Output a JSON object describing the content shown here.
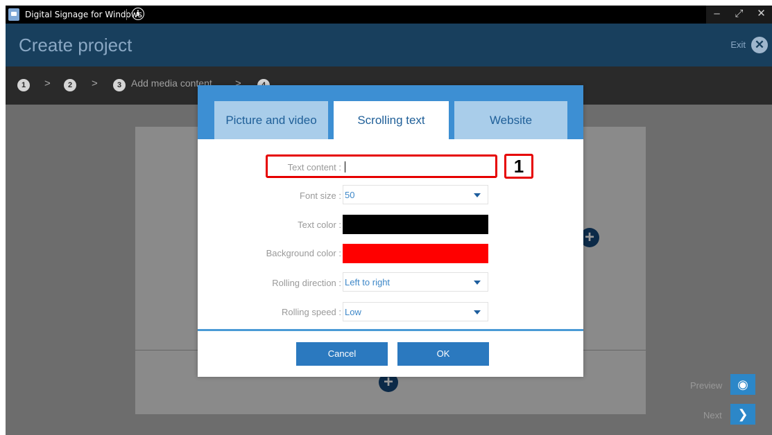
{
  "app": {
    "title": "Digital Signage for Windows",
    "info_icon": "info-icon",
    "window_controls": {
      "minimize": "–",
      "maximize": "⤢",
      "close": "✕"
    }
  },
  "header": {
    "title": "Create project",
    "exit_label": "Exit",
    "exit_icon": "close-icon"
  },
  "steps": [
    {
      "number": "1"
    },
    {
      "number": "2"
    },
    {
      "number": "3",
      "label": "Add media content"
    },
    {
      "number": "4"
    }
  ],
  "step_separator": ">",
  "content": {
    "add_icon": "+"
  },
  "side": {
    "preview_label": "Preview",
    "preview_icon": "eye-icon",
    "next_label": "Next",
    "next_icon": "chevron-right-icon"
  },
  "dialog": {
    "tabs": [
      {
        "label": "Picture and video",
        "active": false
      },
      {
        "label": "Scrolling text",
        "active": true
      },
      {
        "label": "Website",
        "active": false
      }
    ],
    "fields": {
      "text_content": {
        "label": "Text content :",
        "value": ""
      },
      "font_size": {
        "label": "Font size :",
        "value": "50"
      },
      "text_color": {
        "label": "Text color :",
        "color": "#000000"
      },
      "background_color": {
        "label": "Background color :",
        "color": "#ff0000"
      },
      "rolling_direction": {
        "label": "Rolling direction :",
        "value": "Left to right"
      },
      "rolling_speed": {
        "label": "Rolling speed :",
        "value": "Low"
      }
    },
    "buttons": {
      "cancel": "Cancel",
      "ok": "OK"
    }
  },
  "annotation": {
    "number": "1",
    "color": "#e60000"
  }
}
